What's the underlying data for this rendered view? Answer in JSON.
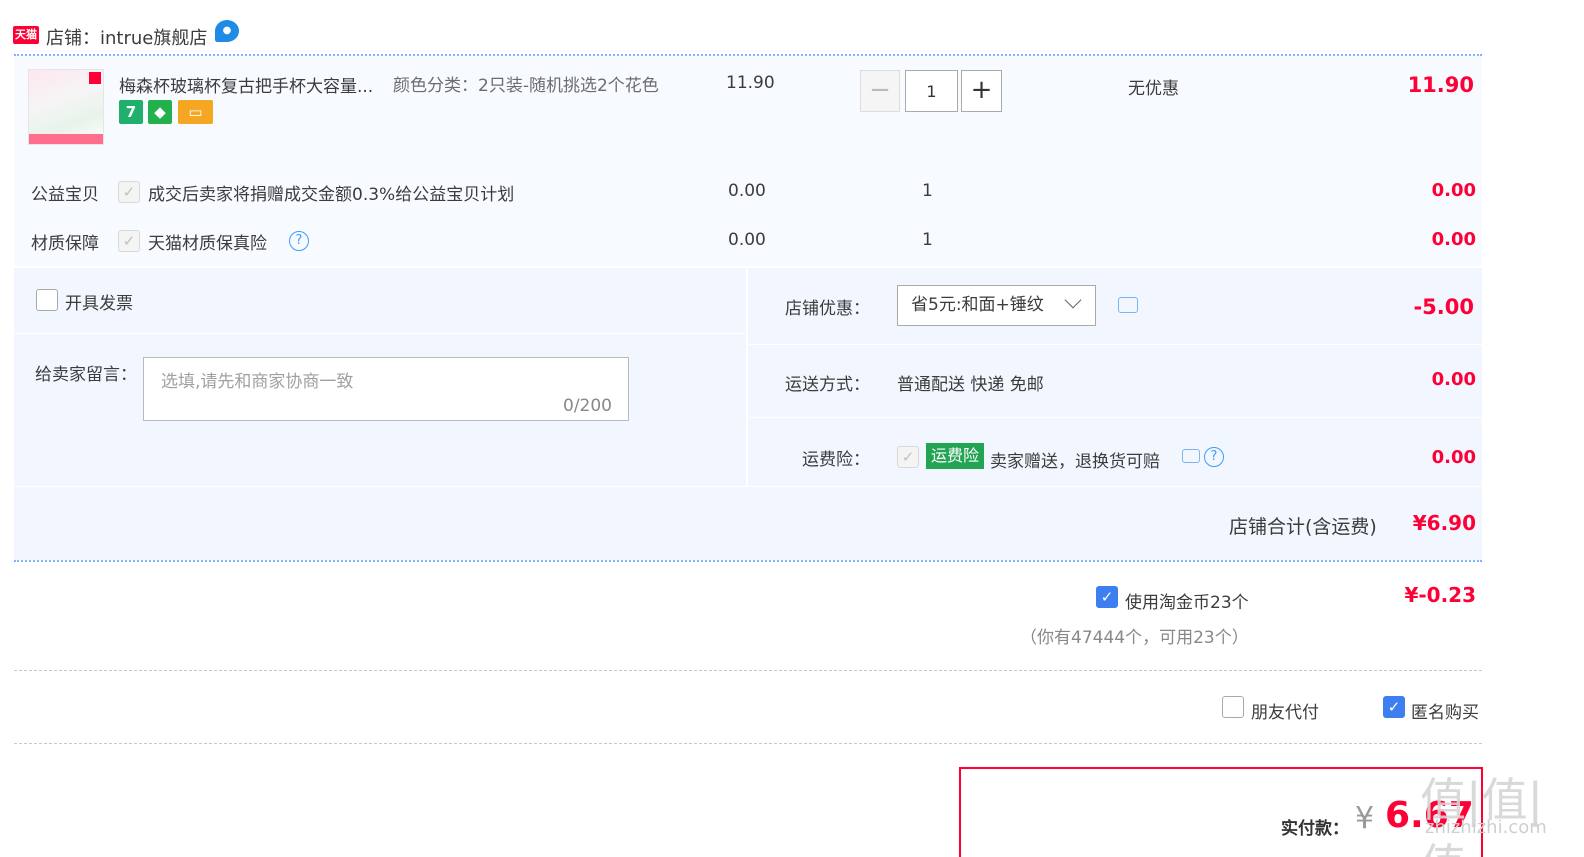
{
  "shop": {
    "logo_text": "天猫",
    "title": "店铺：intrue旗舰店",
    "ww_icon": "wangwang-chat-icon"
  },
  "item": {
    "title": "梅森杯玻璃杯复古把手杯大容量...",
    "badges": [
      "7"
    ],
    "sku": "颜色分类：2只装-随机挑选2个花色",
    "price": "11.90",
    "qty": "1",
    "minus": "−",
    "plus": "+",
    "discount": "无优惠",
    "subtotal": "11.90"
  },
  "services": [
    {
      "label": "公益宝贝",
      "text": "成交后卖家将捐赠成交金额0.3%给公益宝贝计划",
      "price": "0.00",
      "qty": "1",
      "total": "0.00"
    },
    {
      "label": "材质保障",
      "text": "天猫材质保真险",
      "price": "0.00",
      "qty": "1",
      "total": "0.00"
    }
  ],
  "invoice": {
    "label": "开具发票"
  },
  "message": {
    "label": "给卖家留言：",
    "placeholder": "选填,请先和商家协商一致",
    "count": "0/200"
  },
  "shop_coupon": {
    "label": "店铺优惠：",
    "selected": "省5元:和面+锤纹",
    "amount": "-5.00"
  },
  "shipping": {
    "label": "运送方式：",
    "value": "普通配送 快递 免邮",
    "amount": "0.00"
  },
  "freight_insurance": {
    "label": "运费险：",
    "badge": "运费险",
    "text": "卖家赠送，退换货可赔",
    "amount": "0.00"
  },
  "shop_total": {
    "label": "店铺合计(含运费)",
    "amount": "¥6.90"
  },
  "coins": {
    "label": "使用淘金币23个",
    "note": "（你有47444个，可用23个）",
    "amount": "¥-0.23"
  },
  "friend_pay": {
    "label": "朋友代付"
  },
  "anonymous": {
    "label": "匿名购买"
  },
  "pay": {
    "label": "实付款：",
    "currency": "¥",
    "amount": "6.67"
  },
  "watermark": {
    "main": "值|值|值",
    "sub": "zhizhizhi.com"
  },
  "colors": {
    "accent": "#ff0036",
    "blue": "#3d7ff0",
    "bg": "#f2f7ff",
    "green": "#23a454"
  }
}
